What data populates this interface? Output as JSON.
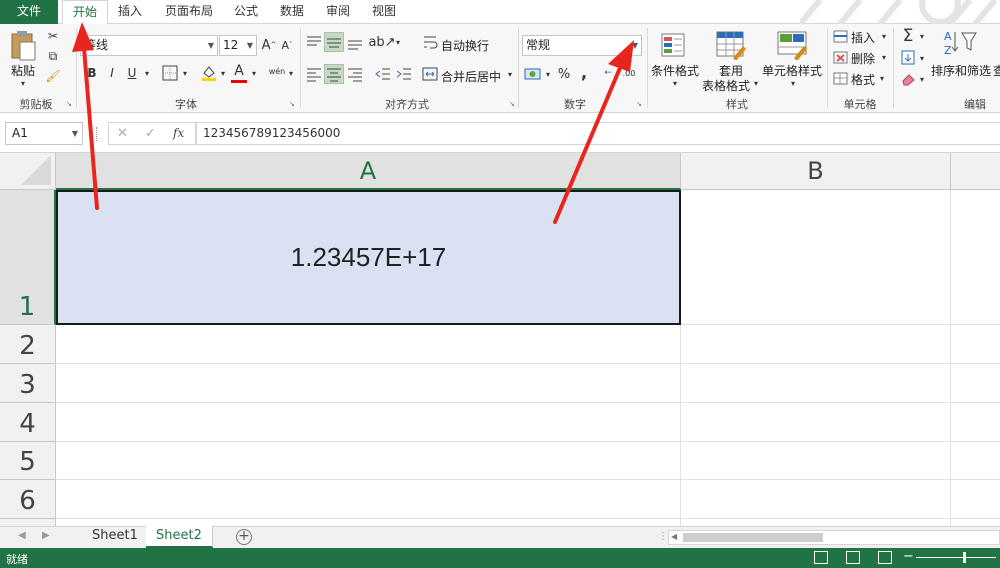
{
  "tabs": {
    "file": "文件",
    "items": [
      "开始",
      "插入",
      "页面布局",
      "公式",
      "数据",
      "审阅",
      "视图"
    ],
    "active_index": 0
  },
  "ribbon": {
    "clipboard": {
      "paste": "粘贴",
      "label": "剪贴板"
    },
    "font": {
      "name": "等线",
      "size": "12",
      "label": "字体",
      "bold": "B",
      "italic": "I",
      "underline": "U",
      "grow": "A",
      "shrink": "A",
      "font_color_glyph": "A",
      "wen": "wén"
    },
    "alignment": {
      "wrap": "自动换行",
      "merge": "合并后居中",
      "label": "对齐方式"
    },
    "number": {
      "format": "常规",
      "label": "数字",
      "percent": "%",
      "comma": ",",
      "dec_more": ".00",
      "dec_less": "←"
    },
    "styles": {
      "conditional": "条件格式",
      "table_line1": "套用",
      "table_line2": "表格格式",
      "cell_styles": "单元格样式",
      "label": "样式"
    },
    "cells": {
      "insert": "插入",
      "delete": "删除",
      "format": "格式",
      "label": "单元格"
    },
    "editing": {
      "sort_filter": "排序和筛选",
      "find_partial": "查",
      "label": "编辑",
      "sigma": "Σ"
    }
  },
  "formula_bar": {
    "name_box": "A1",
    "fx": "fx",
    "cancel": "✕",
    "enter": "✓",
    "content": "123456789123456000"
  },
  "grid": {
    "columns": [
      "A",
      "B"
    ],
    "rows": [
      "1",
      "2",
      "3",
      "4",
      "5",
      "6"
    ],
    "cell_a1": "1.23457E+17"
  },
  "sheets": {
    "tabs": [
      "Sheet1",
      "Sheet2"
    ],
    "active_index": 1,
    "add": "+"
  },
  "status": {
    "ready": "就绪"
  },
  "colors": {
    "excel_green": "#217346",
    "selection_fill": "#d9e1f2",
    "arrow_red": "#e8251f"
  }
}
